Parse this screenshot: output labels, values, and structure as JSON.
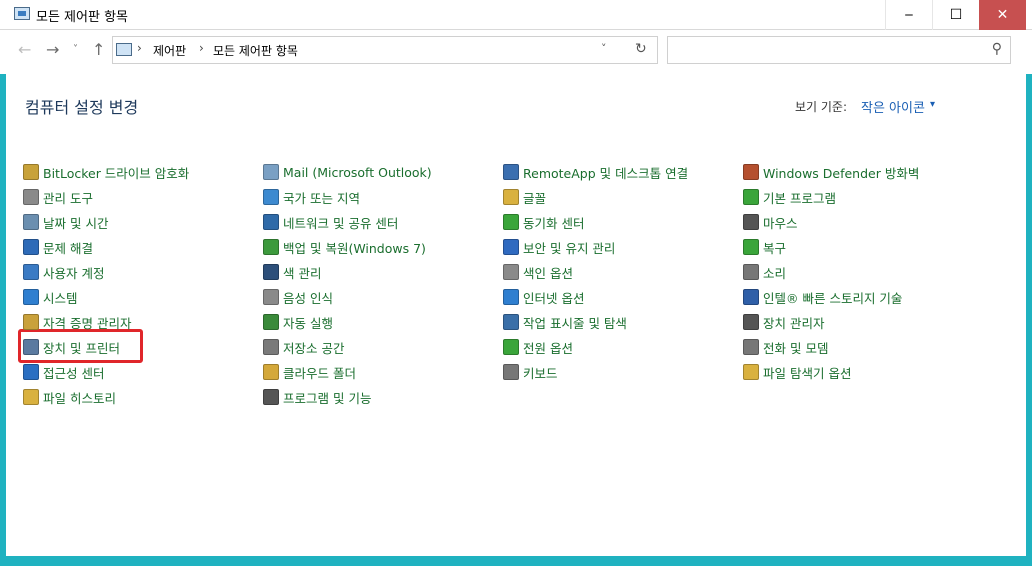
{
  "window": {
    "title": "모든 제어판 항목"
  },
  "window_controls": {
    "minimize": "‒",
    "maximize": "☐",
    "close": "✕"
  },
  "nav": {
    "back": "←",
    "forward": "→",
    "recent": "˅",
    "up": "↑"
  },
  "address": {
    "crumbs": [
      "제어판",
      "모든 제어판 항목"
    ],
    "separator": "›",
    "dropdown": "˅",
    "refresh": "↻"
  },
  "search": {
    "placeholder": "",
    "icon": "search-icon"
  },
  "header": {
    "title": "컴퓨터 설정 변경",
    "viewby_label": "보기 기준:",
    "viewby_value": "작은 아이콘",
    "viewby_arrow": "▾"
  },
  "items": [
    {
      "label": "BitLocker 드라이브 암호화",
      "icon": "bitlocker-icon",
      "color": "#c8a23a"
    },
    {
      "label": "관리 도구",
      "icon": "admin-tools-icon",
      "color": "#8a8a8a"
    },
    {
      "label": "날짜 및 시간",
      "icon": "clock-icon",
      "color": "#6b8fb0"
    },
    {
      "label": "문제 해결",
      "icon": "troubleshoot-icon",
      "color": "#2e6bb8"
    },
    {
      "label": "사용자 계정",
      "icon": "users-icon",
      "color": "#3b7bc4"
    },
    {
      "label": "시스템",
      "icon": "system-icon",
      "color": "#2f7fd0"
    },
    {
      "label": "자격 증명 관리자",
      "icon": "credential-icon",
      "color": "#c9a13b"
    },
    {
      "label": "장치 및 프린터",
      "icon": "devices-printers-icon",
      "color": "#5a7aa0"
    },
    {
      "label": "접근성 센터",
      "icon": "accessibility-icon",
      "color": "#2a6fc2"
    },
    {
      "label": "파일 히스토리",
      "icon": "file-history-icon",
      "color": "#d9b13f"
    },
    {
      "label": "Mail (Microsoft Outlook)",
      "icon": "mail-icon",
      "color": "#7aa0c4"
    },
    {
      "label": "국가 또는 지역",
      "icon": "globe-icon",
      "color": "#3d8ad0"
    },
    {
      "label": "네트워크 및 공유 센터",
      "icon": "network-icon",
      "color": "#2f6aa8"
    },
    {
      "label": "백업 및 복원(Windows 7)",
      "icon": "backup-icon",
      "color": "#3d9a3d"
    },
    {
      "label": "색 관리",
      "icon": "color-mgmt-icon",
      "color": "#2d4f7a"
    },
    {
      "label": "음성 인식",
      "icon": "microphone-icon",
      "color": "#8a8a8a"
    },
    {
      "label": "자동 실행",
      "icon": "autoplay-icon",
      "color": "#3a8a3a"
    },
    {
      "label": "저장소 공간",
      "icon": "storage-icon",
      "color": "#7a7a7a"
    },
    {
      "label": "클라우드 폴더",
      "icon": "cloud-folder-icon",
      "color": "#d4a83a"
    },
    {
      "label": "프로그램 및 기능",
      "icon": "programs-icon",
      "color": "#555555"
    },
    {
      "label": "RemoteApp 및 데스크톱 연결",
      "icon": "remoteapp-icon",
      "color": "#3b6fb0"
    },
    {
      "label": "글꼴",
      "icon": "fonts-icon",
      "color": "#d9b13f"
    },
    {
      "label": "동기화 센터",
      "icon": "sync-icon",
      "color": "#3aa53a"
    },
    {
      "label": "보안 및 유지 관리",
      "icon": "flag-icon",
      "color": "#2f6ac0"
    },
    {
      "label": "색인 옵션",
      "icon": "indexing-icon",
      "color": "#8a8a8a"
    },
    {
      "label": "인터넷 옵션",
      "icon": "internet-icon",
      "color": "#2f7fd0"
    },
    {
      "label": "작업 표시줄 및 탐색",
      "icon": "taskbar-icon",
      "color": "#3a6fa8"
    },
    {
      "label": "전원 옵션",
      "icon": "power-icon",
      "color": "#3aa53a"
    },
    {
      "label": "키보드",
      "icon": "keyboard-icon",
      "color": "#777777"
    },
    {
      "label": "Windows Defender 방화벽",
      "icon": "firewall-icon",
      "color": "#b5502f"
    },
    {
      "label": "기본 프로그램",
      "icon": "default-programs-icon",
      "color": "#3aa53a"
    },
    {
      "label": "마우스",
      "icon": "mouse-icon",
      "color": "#555555"
    },
    {
      "label": "복구",
      "icon": "recovery-icon",
      "color": "#3aa53a"
    },
    {
      "label": "소리",
      "icon": "speaker-icon",
      "color": "#777777"
    },
    {
      "label": "인텔® 빠른 스토리지 기술",
      "icon": "intel-storage-icon",
      "color": "#2f5fa8"
    },
    {
      "label": "장치 관리자",
      "icon": "device-manager-icon",
      "color": "#555555"
    },
    {
      "label": "전화 및 모뎀",
      "icon": "phone-modem-icon",
      "color": "#777777"
    },
    {
      "label": "파일 탐색기 옵션",
      "icon": "folder-options-icon",
      "color": "#d9b13f"
    }
  ]
}
